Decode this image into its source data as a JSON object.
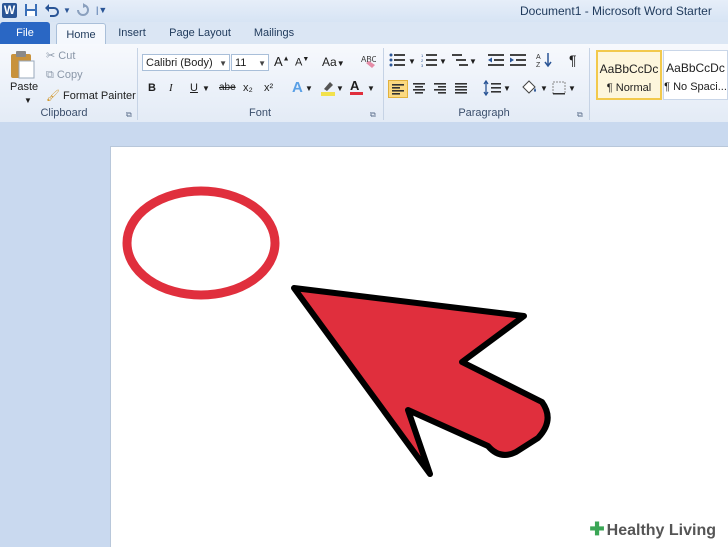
{
  "window": {
    "title": "Document1  -  Microsoft Word Starter",
    "app_icon": "W"
  },
  "quick_access": {
    "save_icon": "save-icon",
    "undo_icon": "undo-icon",
    "redo_icon": "redo-icon",
    "customize_icon": "customize-icon"
  },
  "tabs": [
    {
      "label": "File"
    },
    {
      "label": "Home"
    },
    {
      "label": "Insert"
    },
    {
      "label": "Page Layout"
    },
    {
      "label": "Mailings"
    }
  ],
  "clipboard": {
    "paste_label": "Paste",
    "cut_label": "Cut",
    "copy_label": "Copy",
    "format_painter_label": "Format Painter",
    "group_label": "Clipboard"
  },
  "font": {
    "font_name": "Calibri (Body)",
    "font_size": "11",
    "grow": "A",
    "shrink": "A",
    "change_case": "Aa",
    "bold": "B",
    "italic": "I",
    "underline": "U",
    "strikethrough": "abe",
    "subscript": "x₂",
    "superscript": "x²",
    "text_effects": "A",
    "font_color": "A",
    "group_label": "Font"
  },
  "paragraph": {
    "group_label": "Paragraph",
    "pilcrow": "¶"
  },
  "styles": [
    {
      "sample": "AaBbCcDc",
      "name": "¶ Normal"
    },
    {
      "sample": "AaBbCcDc",
      "name": "¶ No Spaci..."
    }
  ],
  "watermark": {
    "text": "Healthy Living"
  },
  "colors": {
    "accent_red": "#e02f3d",
    "file_tab": "#2a67c4",
    "highlight": "#f2e14c"
  }
}
